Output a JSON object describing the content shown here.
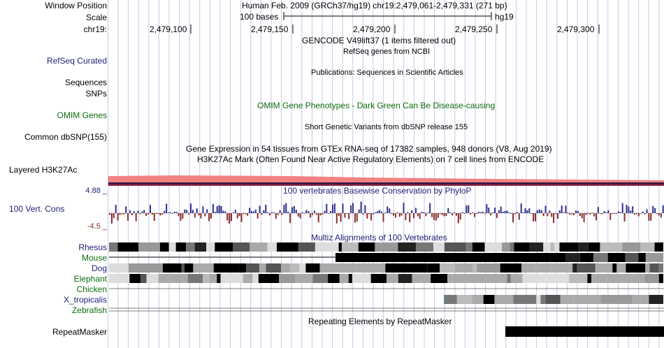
{
  "header": {
    "window_position_label": "Window Position",
    "scale_label": "Scale",
    "chrom_label": "chr19:",
    "assembly_text": "Human Feb. 2009 (GRCh37/hg19)   chr19:2,479,061-2,479,331 (271 bp)",
    "scale_text": "100 bases",
    "db_text": "hg19",
    "ticks": [
      "2,479,100",
      "2,479,150",
      "2,479,200",
      "2,479,250",
      "2,479,300"
    ]
  },
  "tracks": {
    "gencode_title": "GENCODE V49lift37 (1 items filtered out)",
    "refseq_subtitle": "RefSeq genes from NCBI",
    "refseq_label": "RefSeq Curated",
    "publications_title": "Publications: Sequences in Scientific Articles",
    "sequences_label": "Sequences",
    "snps_label": "SNPs",
    "omim_label": "OMIM Genes",
    "omim_title": "OMIM Gene Phenotypes - Dark Green Can Be Disease-causing",
    "dbsnp_title": "Short Genetic Variants from dbSNP release 155",
    "dbsnp_label": "Common dbSNP(155)",
    "gtex_title": "Gene Expression in 54 tissues from GTEx RNA-seq of 17382 samples, 948 donors (V8, Aug 2019)",
    "h3k27ac_title": "H3K27Ac Mark (Often Found Near Active Regulatory Elements) on 7 cell lines from ENCODE",
    "h3k27ac_label": "Layered H3K27Ac",
    "phylop_max": "4.88 _",
    "phylop_title": "100 vertebrates Basewise Conservation by PhyloP",
    "phylop_label": "100 Vert. Cons",
    "phylop_min": "-4.5 _",
    "multiz_title": "Multiz Alignments of 100 Vertebrates",
    "species": [
      "Rhesus",
      "Mouse",
      "Dog",
      "Elephant",
      "Chicken",
      "X_tropicalis",
      "Zebrafish"
    ],
    "repeat_title": "Repeating Elements by RepeatMasker",
    "repeat_label": "RepeatMasker"
  },
  "colors": {
    "navy_label": "#1f1f77",
    "green_label": "#0c6c0c",
    "conservation_pos": "#2f2f8f",
    "conservation_neg": "#8b2d2d",
    "h3k27ac_fill": "#f28282",
    "grid": "#c8c8e8"
  }
}
